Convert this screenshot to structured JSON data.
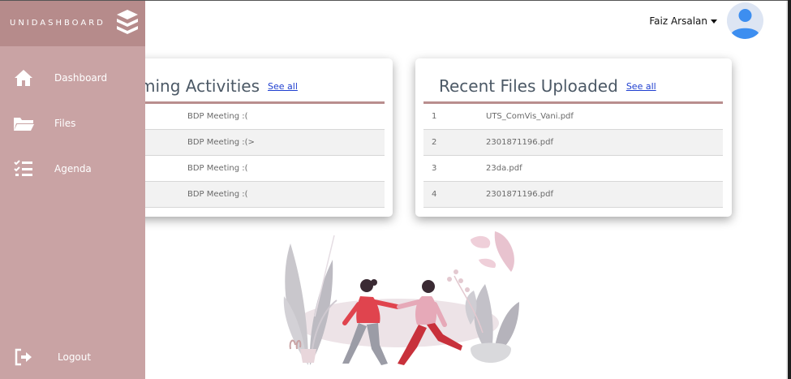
{
  "sidebar": {
    "brand": "UNIDASHBOARD",
    "items": [
      {
        "label": "Dashboard",
        "icon": "home-icon"
      },
      {
        "label": "Files",
        "icon": "folder-open-icon"
      },
      {
        "label": "Agenda",
        "icon": "checklist-icon"
      }
    ],
    "logout": {
      "label": "Logout",
      "icon": "logout-icon"
    }
  },
  "header": {
    "user_name": "Faiz Arsalan",
    "avatar_icon": "user-avatar-icon"
  },
  "activities": {
    "title": "ming Activities",
    "see_all": "See all",
    "rows": [
      {
        "name": "BDP Meeting :("
      },
      {
        "name": "BDP Meeting :(>"
      },
      {
        "name": "BDP Meeting :("
      },
      {
        "name": "BDP Meeting :("
      }
    ]
  },
  "files": {
    "title": "Recent Files Uploaded",
    "see_all": "See all",
    "rows": [
      {
        "no": "1",
        "name": "UTS_ComVis_Vani.pdf"
      },
      {
        "no": "2",
        "name": "2301871196.pdf"
      },
      {
        "no": "3",
        "name": "23da.pdf"
      },
      {
        "no": "4",
        "name": "2301871196.pdf"
      }
    ]
  },
  "colors": {
    "sidebar": "#c9a3a4",
    "brand_bar": "#b68b8b",
    "card_rule": "#b98e8e",
    "link": "#1f3fd0",
    "title_text": "#4c5966"
  }
}
